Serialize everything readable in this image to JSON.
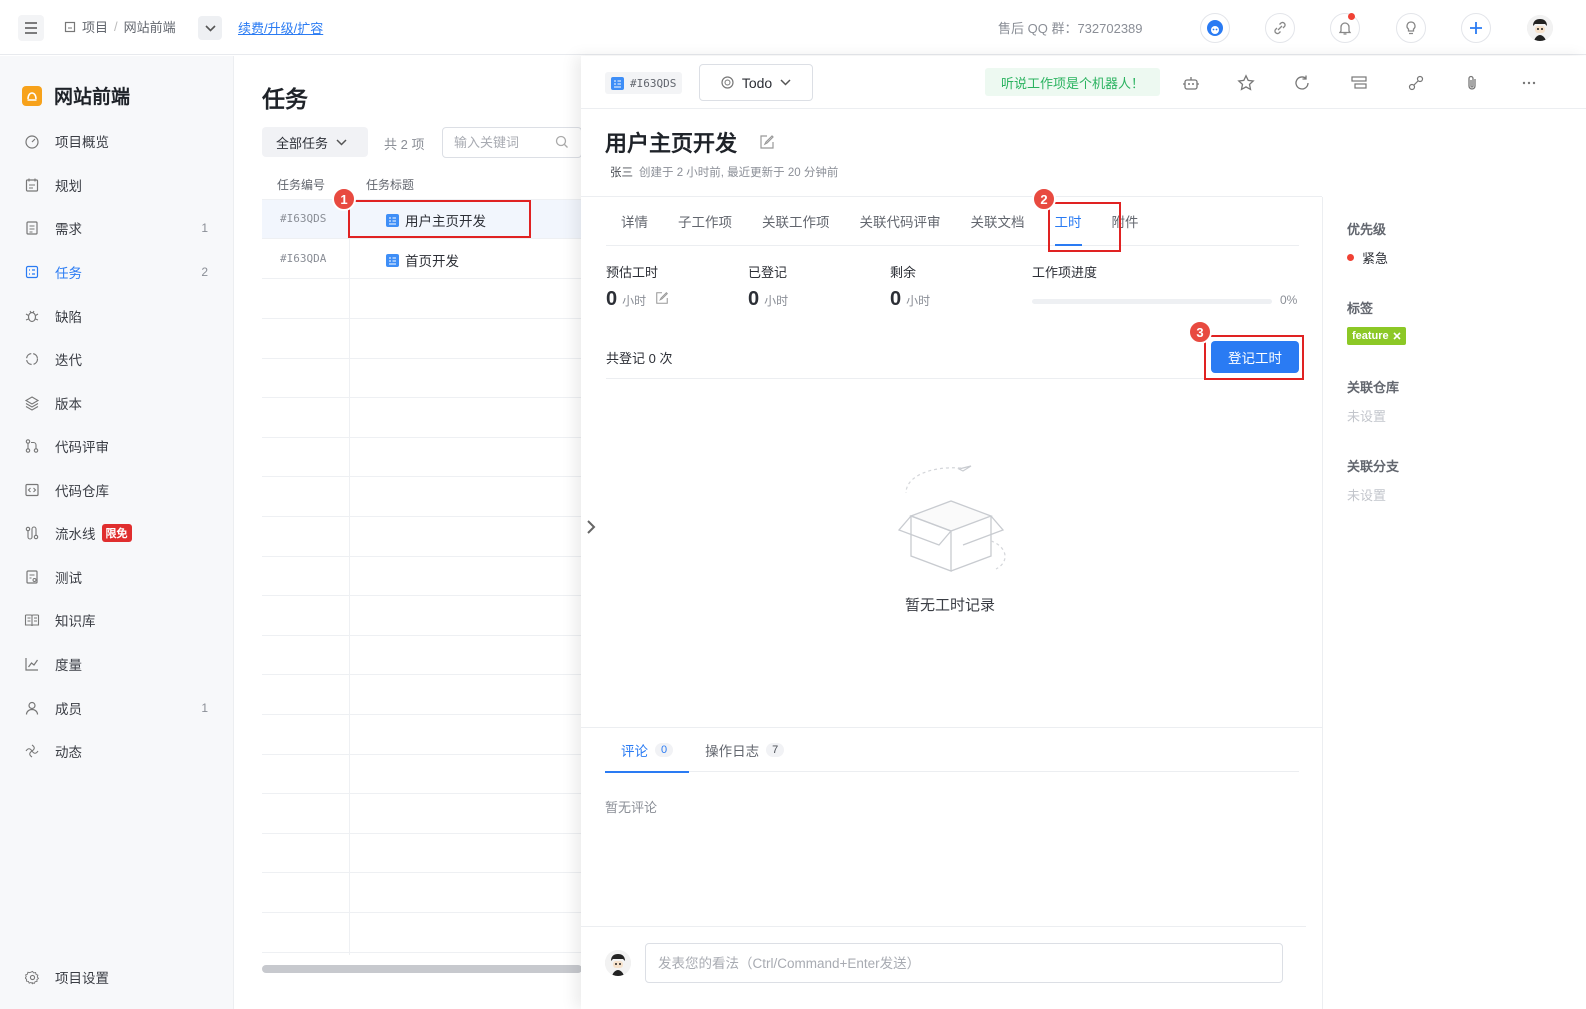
{
  "topbar": {
    "breadcrumb": [
      "项目",
      "/",
      "网站前端"
    ],
    "renew_link": "续费/升级/扩容",
    "qq_group": "售后 QQ 群：732702389"
  },
  "sidebar": {
    "project_name": "网站前端",
    "items": [
      {
        "label": "项目概览",
        "icon": "dashboard-icon",
        "count": ""
      },
      {
        "label": "规划",
        "icon": "calendar-icon",
        "count": ""
      },
      {
        "label": "需求",
        "icon": "document-icon",
        "count": "1"
      },
      {
        "label": "任务",
        "icon": "task-icon",
        "count": "2",
        "active": true
      },
      {
        "label": "缺陷",
        "icon": "bug-icon",
        "count": ""
      },
      {
        "label": "迭代",
        "icon": "cycle-icon",
        "count": ""
      },
      {
        "label": "版本",
        "icon": "layers-icon",
        "count": ""
      },
      {
        "label": "代码评审",
        "icon": "merge-icon",
        "count": ""
      },
      {
        "label": "代码仓库",
        "icon": "code-icon",
        "count": ""
      },
      {
        "label": "流水线",
        "icon": "pipeline-icon",
        "count": "",
        "badge": "限免"
      },
      {
        "label": "测试",
        "icon": "test-icon",
        "count": ""
      },
      {
        "label": "知识库",
        "icon": "book-icon",
        "count": ""
      },
      {
        "label": "度量",
        "icon": "chart-icon",
        "count": ""
      },
      {
        "label": "成员",
        "icon": "user-icon",
        "count": "1"
      },
      {
        "label": "动态",
        "icon": "activity-icon",
        "count": ""
      }
    ],
    "settings_label": "项目设置"
  },
  "tasklist": {
    "heading": "任务",
    "filter_label": "全部任务",
    "count_text": "共 2 项",
    "search_placeholder": "输入关键词",
    "col_id": "任务编号",
    "col_title": "任务标题",
    "rows": [
      {
        "id": "#I63QDS",
        "title": "用户主页开发"
      },
      {
        "id": "#I63QDA",
        "title": "首页开发"
      }
    ]
  },
  "steps": [
    "1",
    "2",
    "3"
  ],
  "drawer": {
    "issue_id": "#I63QDS",
    "status": "Todo",
    "robot_tip": "听说工作项是个机器人！",
    "title": "用户主页开发",
    "author": "张三",
    "meta": "创建于 2 小时前, 最近更新于 20 分钟前",
    "tabs": [
      "详情",
      "子工作项",
      "关联工作项",
      "关联代码评审",
      "关联文档",
      "工时",
      "附件"
    ],
    "active_tab": 5,
    "timelog": {
      "estimate_label": "预估工时",
      "estimate_value": "0",
      "logged_label": "已登记",
      "logged_value": "0",
      "remain_label": "剩余",
      "remain_value": "0",
      "unit": "小时",
      "progress_label": "工作项进度",
      "progress_pct": "0%",
      "progress_value": 0,
      "log_count": "共登记 0 次",
      "log_button": "登记工时",
      "empty_text": "暂无工时记录"
    },
    "side": {
      "priority_label": "优先级",
      "priority_value": "紧急",
      "priority_color": "#f04134",
      "tags_label": "标签",
      "tag": "feature",
      "repo_label": "关联仓库",
      "repo_value": "未设置",
      "branch_label": "关联分支",
      "branch_value": "未设置"
    },
    "comments": {
      "tab_comment": "评论",
      "comment_count": "0",
      "tab_log": "操作日志",
      "log_count": "7",
      "empty": "暂无评论",
      "input_placeholder": "发表您的看法（Ctrl/Command+Enter发送）"
    }
  },
  "colors": {
    "accent": "#2a7bf3",
    "highlight": "#e02222",
    "danger": "#f04134",
    "success": "#2bb360"
  }
}
